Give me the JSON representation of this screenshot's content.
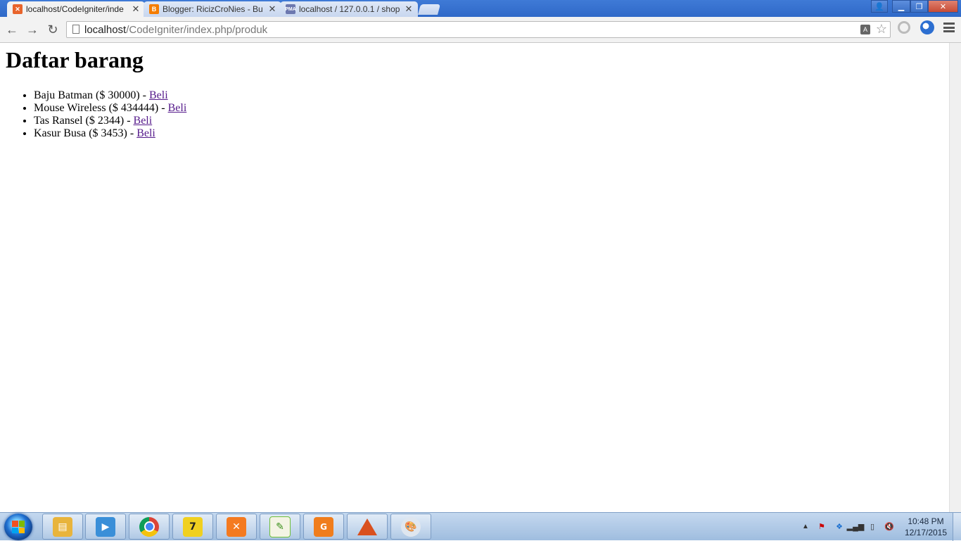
{
  "browser": {
    "tabs": [
      {
        "title": "localhost/CodeIgniter/inde",
        "active": true,
        "favicon_color": "#e8642c"
      },
      {
        "title": "Blogger: RicizCroNies - Bu",
        "active": false,
        "favicon_color": "#f57d00"
      },
      {
        "title": "localhost / 127.0.0.1 / shop",
        "active": false,
        "favicon_color": "#6c78af"
      }
    ],
    "url_host": "localhost",
    "url_path": "/CodeIgniter/index.php/produk"
  },
  "page": {
    "heading": "Daftar barang",
    "products": [
      {
        "text": "Baju Batman ($ 30000) - ",
        "link": "Beli"
      },
      {
        "text": "Mouse Wireless ($ 434444) - ",
        "link": "Beli"
      },
      {
        "text": "Tas Ransel ($ 2344) - ",
        "link": "Beli"
      },
      {
        "text": "Kasur Busa ($ 3453) - ",
        "link": "Beli"
      }
    ],
    "link_color": "#551a8b"
  },
  "taskbar": {
    "apps": [
      {
        "name": "windows-explorer",
        "color": "#e8b43c"
      },
      {
        "name": "media-player",
        "color": "#3a8fd8"
      },
      {
        "name": "chrome",
        "color": "#db4437"
      },
      {
        "name": "unknown-7",
        "color": "#f0d020"
      },
      {
        "name": "xampp",
        "color": "#f47a20"
      },
      {
        "name": "notepad-plus",
        "color": "#6fbf3a"
      },
      {
        "name": "foxit-pdf",
        "color": "#f07d1c"
      },
      {
        "name": "matlab",
        "color": "#d9501e"
      },
      {
        "name": "paint",
        "color": "#9aa7b8"
      }
    ],
    "clock_time": "10:48 PM",
    "clock_date": "12/17/2015"
  }
}
